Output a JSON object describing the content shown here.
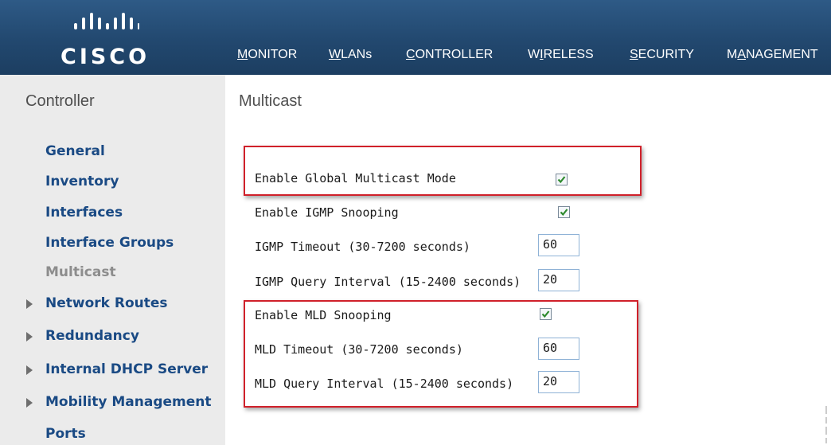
{
  "brand": {
    "logo_text": "CISCO"
  },
  "nav": {
    "items": [
      {
        "label": "MONITOR",
        "underline": "M",
        "rest": "ONITOR"
      },
      {
        "label": "WLANs",
        "underline": "W",
        "rest": "LANs"
      },
      {
        "label": "CONTROLLER",
        "underline": "C",
        "rest": "ONTROLLER",
        "active": true
      },
      {
        "label": "WIRELESS",
        "pre": "W",
        "underline": "I",
        "rest": "RELESS"
      },
      {
        "label": "SECURITY",
        "underline": "S",
        "rest": "ECURITY"
      },
      {
        "label": "MANAGEMENT",
        "pre": "M",
        "underline": "A",
        "rest": "NAGEMENT"
      }
    ],
    "active_color": "#e49b30"
  },
  "sidebar": {
    "title": "Controller",
    "items": [
      {
        "label": "General"
      },
      {
        "label": "Inventory"
      },
      {
        "label": "Interfaces"
      },
      {
        "label": "Interface Groups"
      },
      {
        "label": "Multicast",
        "current": true
      },
      {
        "label": "Network Routes",
        "expandable": true
      },
      {
        "label": "Redundancy",
        "expandable": true
      },
      {
        "label": "Internal DHCP Server",
        "expandable": true
      },
      {
        "label": "Mobility Management",
        "expandable": true
      },
      {
        "label": "Ports"
      }
    ]
  },
  "main": {
    "title": "Multicast",
    "fields": {
      "global_multicast": {
        "label": "Enable Global Multicast Mode",
        "checked": true
      },
      "igmp_snooping": {
        "label": "Enable IGMP Snooping",
        "checked": true
      },
      "igmp_timeout": {
        "label": "IGMP Timeout (30-7200 seconds)",
        "value": "60"
      },
      "igmp_query": {
        "label": "IGMP Query Interval (15-2400 seconds)",
        "value": "20"
      },
      "mld_snooping": {
        "label": "Enable MLD Snooping",
        "checked": true
      },
      "mld_timeout": {
        "label": "MLD Timeout (30-7200 seconds)",
        "value": "60"
      },
      "mld_query": {
        "label": "MLD Query Interval (15-2400 seconds)",
        "value": "20"
      }
    },
    "highlight_color": "#d0202a"
  },
  "colors": {
    "header": "#22486f",
    "link": "#1a4a84",
    "check": "#2e8a2e"
  }
}
